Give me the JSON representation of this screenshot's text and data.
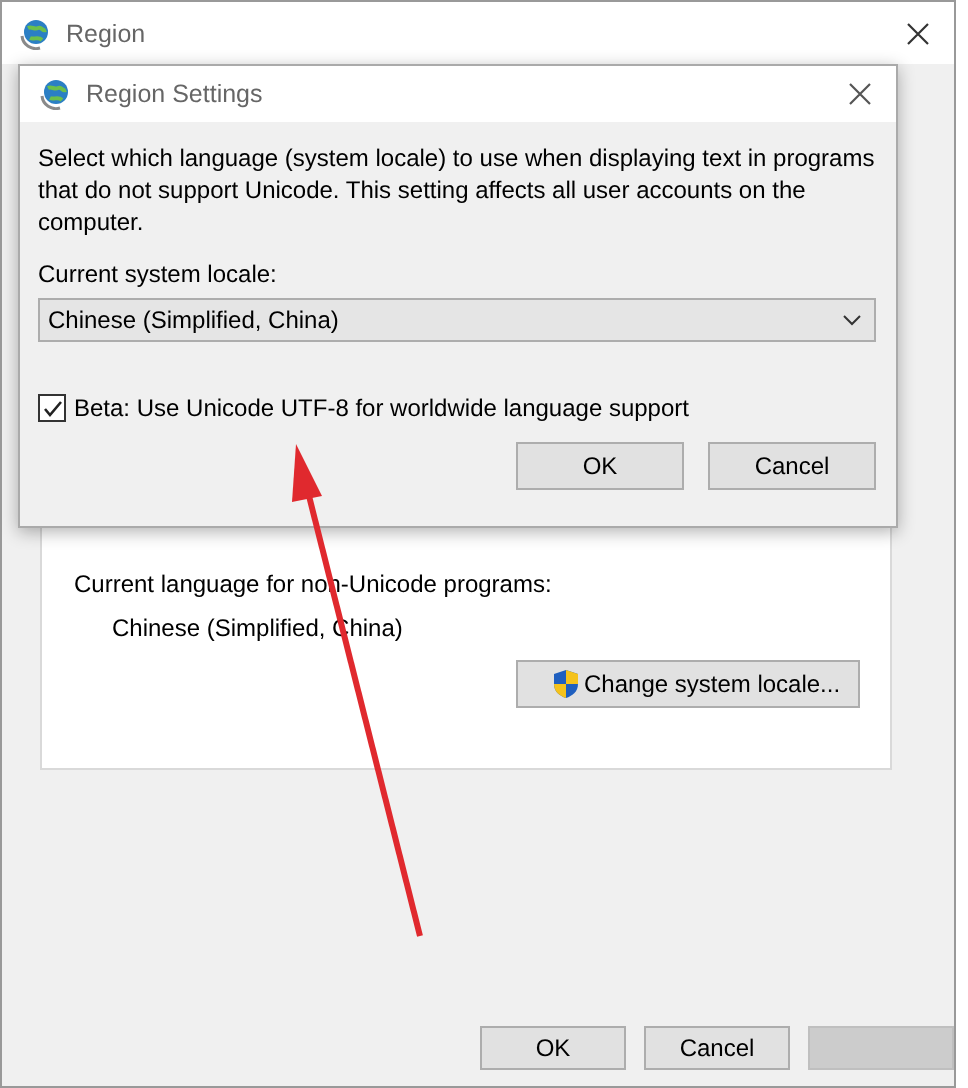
{
  "window": {
    "title": "Region"
  },
  "panel": {
    "label": "Current language for non-Unicode programs:",
    "value": "Chinese (Simplified, China)",
    "button": "Change system locale..."
  },
  "buttons": [
    {
      "label": "OK",
      "disabled": false
    },
    {
      "label": "Cancel",
      "disabled": false
    },
    {
      "disabled": true
    }
  ],
  "dialog": {
    "title": "Region Settings",
    "description": "Select which language (system locale) to use when displaying text in programs that do not support Unicode. This setting affects all user accounts on the computer.",
    "locale_label": "Current system locale:",
    "locale_value": "Chinese (Simplified, China)",
    "beta": {
      "label": "Beta: Use Unicode UTF-8 for worldwide language support",
      "checked": true
    },
    "buttons": [
      {
        "label": "OK"
      },
      {
        "label": "Cancel"
      }
    ]
  }
}
